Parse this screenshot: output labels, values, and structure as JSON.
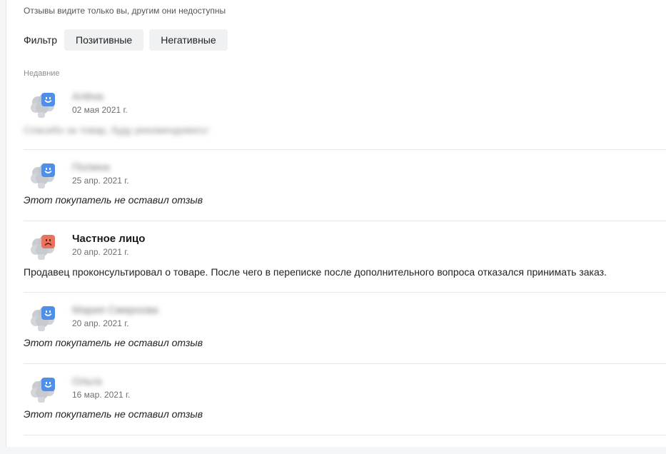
{
  "notice": "Отзывы видите только вы, другим они недоступны",
  "filter": {
    "label": "Фильтр",
    "positive": "Позитивные",
    "negative": "Негативные"
  },
  "section_label": "Недавние",
  "colors": {
    "positive": "#4f8fe8",
    "negative": "#e8735f"
  },
  "reviews": [
    {
      "name": "Алёна",
      "date": "02 мая 2021 г.",
      "sentiment": "positive",
      "text": "Спасибо за товар, буду рекомендовать!",
      "name_blurred": true,
      "text_blurred": true
    },
    {
      "name": "Полина",
      "date": "25 апр. 2021 г.",
      "sentiment": "positive",
      "text": "Этот покупатель не оставил отзыв",
      "name_blurred": true,
      "text_blurred": false
    },
    {
      "name": "Частное лицо",
      "date": "20 апр. 2021 г.",
      "sentiment": "negative",
      "text": "Продавец проконсультировал о товаре. После чего в переписке после дополнительного вопроса отказался принимать заказ.",
      "name_blurred": false,
      "text_blurred": false
    },
    {
      "name": "Мария Смирнова",
      "date": "20 апр. 2021 г.",
      "sentiment": "positive",
      "text": "Этот покупатель не оставил отзыв",
      "name_blurred": true,
      "text_blurred": false
    },
    {
      "name": "Ольга",
      "date": "16 мар. 2021 г.",
      "sentiment": "positive",
      "text": "Этот покупатель не оставил отзыв",
      "name_blurred": true,
      "text_blurred": false
    }
  ]
}
